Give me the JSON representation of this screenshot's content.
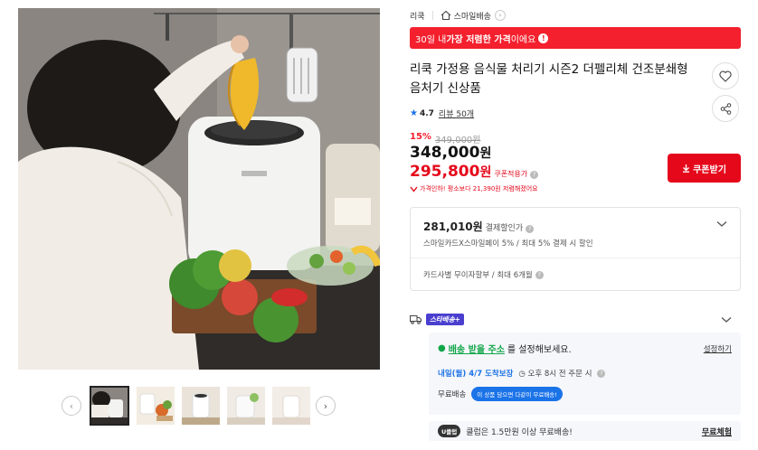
{
  "gallery": {
    "prev_label": "‹",
    "next_label": "›",
    "thumbnail_count": 5,
    "active_index": 0
  },
  "breadcrumb": {
    "brand": "리쿡",
    "store": "스마일배송"
  },
  "lowest_price_banner": {
    "prefix": "30일 내 ",
    "highlight": "가장 저렴한 가격",
    "suffix": "이에요"
  },
  "product": {
    "title": "리쿡 가정용 음식물 처리기 시즌2 더펠리체 건조분쇄형 음처기 신상품",
    "rating": "4.7",
    "review_label": "리뷰 50개"
  },
  "price": {
    "discount_percent": "15%",
    "original": "349,000원",
    "sale_number": "348,000",
    "sale_unit": "원",
    "coupon_number": "295,800",
    "coupon_unit": "원",
    "coupon_tag": "쿠폰적용가",
    "note": "가격인하! 평소보다 21,390원 저렴해졌어요"
  },
  "coupon_button": {
    "label": "쿠폰받기"
  },
  "payment": {
    "price": "281,010원",
    "label": "결제할인가",
    "detail": "스마일카드X스마일페이 5% / 최대 5% 결제 시 할인",
    "card": "카드사별 무이자할부 / 최대 6개월"
  },
  "shipping": {
    "badge": "스타배송+",
    "address_link": "배송 받을 주소",
    "address_suffix": "를 설정해보세요.",
    "settings_link": "설정하기",
    "delivery_date": "내일(월) 4/7 도착보장",
    "cutoff": "오후 8시 전 주문 시",
    "free_label": "무료배송",
    "free_pill": "이 상품 담으면 다같이 무료배송!"
  },
  "uclub": {
    "badge": "U클럽",
    "text": "클럽은 1.5만원 이상 무료배송!",
    "link": "무료체험"
  },
  "colors": {
    "accent_red": "#f4202e",
    "price_red": "#e5081b",
    "shipping_blue": "#1b73e8",
    "star_purple": "#4a3fcf",
    "address_green": "#12a64a"
  }
}
